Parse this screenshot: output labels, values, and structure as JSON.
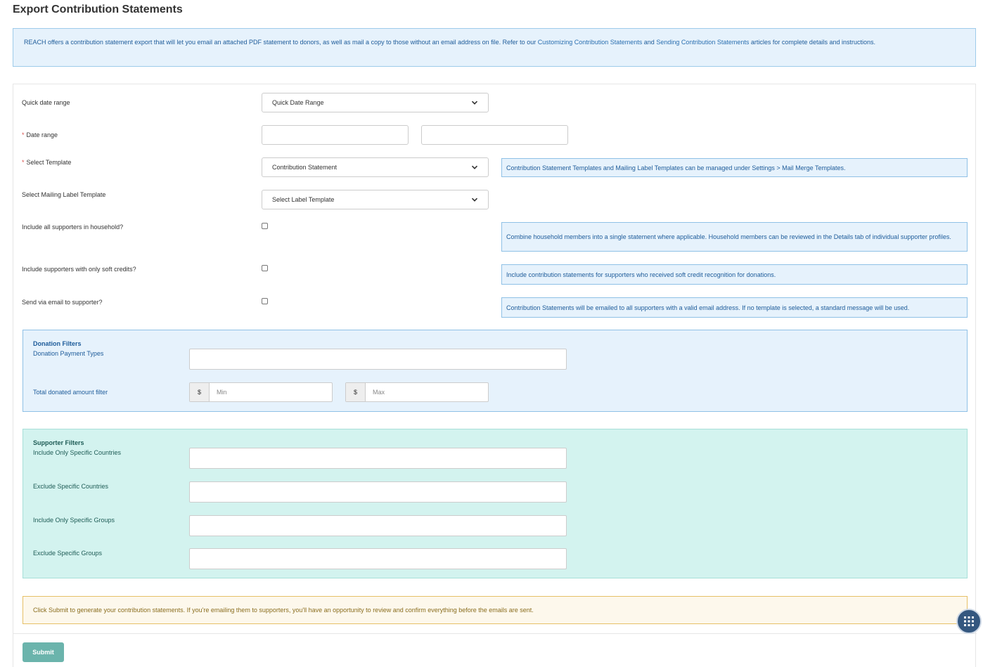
{
  "page": {
    "title": "Export Contribution Statements"
  },
  "intro": {
    "text_1": "REACH offers a contribution statement export that will let you email an attached PDF statement to donors, as well as mail a copy to those without an email address on file. Refer to our ",
    "link_1": "Customizing Contribution Statements",
    "text_2": " and ",
    "link_2": "Sending Contribution Statements",
    "text_3": " articles for complete details and instructions."
  },
  "form": {
    "quick_date_range": {
      "label": "Quick date range",
      "value": "Quick Date Range"
    },
    "date_range": {
      "label": "Date range",
      "start_value": "",
      "end_value": ""
    },
    "template": {
      "label": "Select Template",
      "value": "Contribution Statement",
      "help": "Contribution Statement Templates and Mailing Label Templates can be managed under Settings > Mail Merge Templates."
    },
    "mailing_label": {
      "label": "Select Mailing Label Template",
      "value": "Select Label Template"
    },
    "household": {
      "label": "Include all supporters in household?",
      "checked": false,
      "help": "Combine household members into a single statement where applicable. Household members can be reviewed in the Details tab of individual supporter profiles."
    },
    "soft_credits": {
      "label": "Include supporters with only soft credits?",
      "checked": false,
      "help": "Include contribution statements for supporters who received soft credit recognition for donations."
    },
    "send_email": {
      "label": "Send via email to supporter?",
      "checked": false,
      "help": "Contribution Statements will be emailed to all supporters with a valid email address. If no template is selected, a standard message will be used."
    }
  },
  "donation_filters": {
    "title": "Donation Filters",
    "payment_types_label": "Donation Payment Types",
    "amount_label": "Total donated amount filter",
    "currency_symbol": "$",
    "min_placeholder": "Min",
    "max_placeholder": "Max"
  },
  "supporter_filters": {
    "title": "Supporter Filters",
    "include_countries_label": "Include Only Specific Countries",
    "exclude_countries_label": "Exclude Specific Countries",
    "include_groups_label": "Include Only Specific Groups",
    "exclude_groups_label": "Exclude Specific Groups"
  },
  "notice": {
    "text": "Click Submit to generate your contribution statements. If you're emailing them to supporters, you'll have an opportunity to review and confirm everything before the emails are sent."
  },
  "actions": {
    "submit_label": "Submit"
  },
  "colors": {
    "info_bg": "#e6f2fc",
    "info_text": "#1e5c9a",
    "supporter_bg": "#d3f3ef",
    "notice_bg": "#fdf8ec",
    "submit_bg": "#6bb4ac",
    "fab_bg": "#34577f",
    "required": "#d9534f"
  },
  "icons": {
    "select_arrow": "chevron-down-icon",
    "fab": "grid-menu-icon"
  }
}
